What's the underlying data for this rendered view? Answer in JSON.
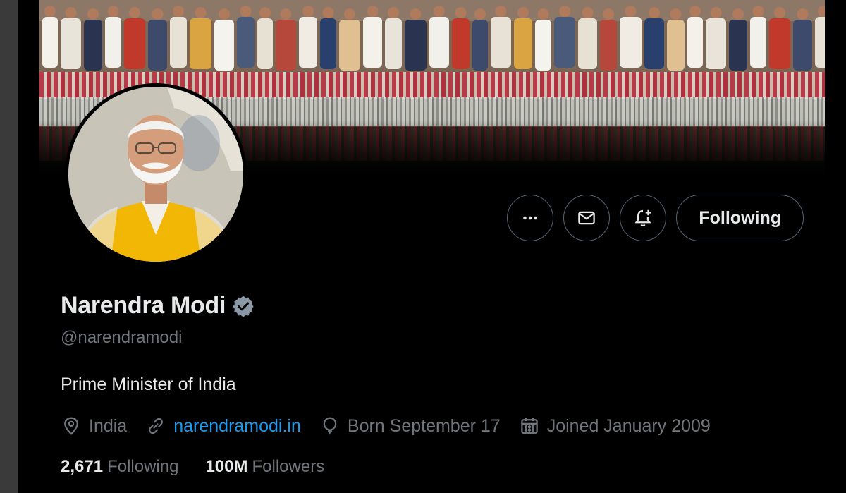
{
  "profile": {
    "display_name": "Narendra Modi",
    "handle": "@narendramodi",
    "bio": "Prime Minister of India",
    "verified_badge_color": "#8b98a5",
    "meta": {
      "location": "India",
      "website": "narendramodi.in",
      "birthday": "Born September 17",
      "joined": "Joined January 2009"
    },
    "stats": {
      "following_count": "2,671",
      "following_label": "Following",
      "followers_count": "100M",
      "followers_label": "Followers"
    }
  },
  "actions": {
    "more_icon": "more-horizontal-icon",
    "message_icon": "envelope-icon",
    "notify_icon": "bell-plus-icon",
    "following_label": "Following"
  },
  "colors": {
    "background": "#000000",
    "text_primary": "#e7e9ea",
    "text_secondary": "#71767b",
    "link": "#1d9bf0",
    "button_border": "#536471"
  }
}
